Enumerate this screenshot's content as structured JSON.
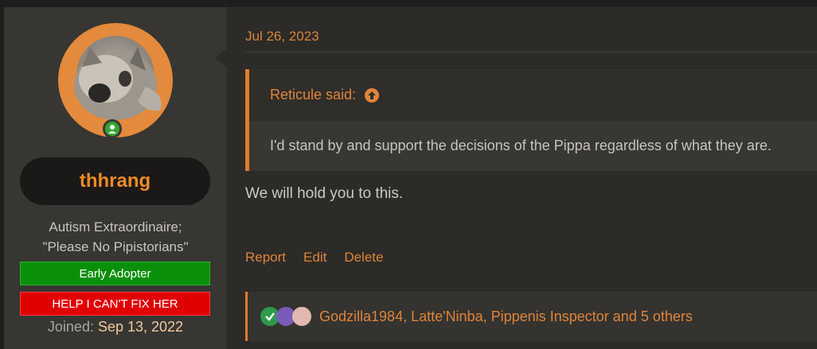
{
  "user": {
    "username": "thhrang",
    "title_line1": "Autism Extraordinaire;",
    "title_line2": "\"Please No Pipistorians\"",
    "banners": [
      "Early Adopter",
      "HELP I CAN'T FIX HER"
    ],
    "joined_label": "Joined:",
    "joined_date": "Sep 13, 2022",
    "avatar_icon": "user-avatar-icon",
    "online_icon": "online-status-icon"
  },
  "post": {
    "date": "Jul 26, 2023",
    "quote": {
      "author_said": "Reticule said:",
      "text": "I'd stand by and support the decisions of the Pippa regardless of what they are."
    },
    "reply": "We will hold you to this.",
    "actions": [
      "Report",
      "Edit",
      "Delete"
    ],
    "reactions": {
      "icons": [
        "check-reaction-icon",
        "purple-character-reaction-icon",
        "pink-character-reaction-icon"
      ],
      "users": "Godzilla1984, Latte'Ninba, Pippenis Inspector and 5 others"
    }
  },
  "colors": {
    "accent": "#e0843a",
    "username": "#f08a24",
    "banner_green": "#0a8f0a",
    "banner_red": "#e00000"
  }
}
